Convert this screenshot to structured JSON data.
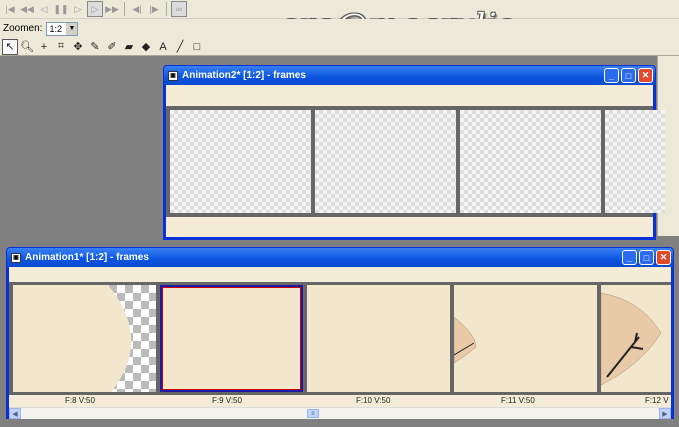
{
  "toolbar": {
    "zoom_label": "Zoomen:",
    "zoom_value": "1:2"
  },
  "watermark": "cre@maarylis",
  "window2": {
    "title": "Animation2* [1:2] - frames"
  },
  "window1": {
    "title": "Animation1* [1:2] - frames",
    "frames": [
      {
        "label": "F:8  V:50"
      },
      {
        "label": "F:9  V:50"
      },
      {
        "label": "F:10  V:50"
      },
      {
        "label": "F:11  V:50"
      },
      {
        "label": "F:12  V"
      }
    ]
  },
  "colors": {
    "title_blue": "#0a54e0",
    "frame_beige": "#f2e6cc",
    "close_red": "#e04a2a"
  }
}
